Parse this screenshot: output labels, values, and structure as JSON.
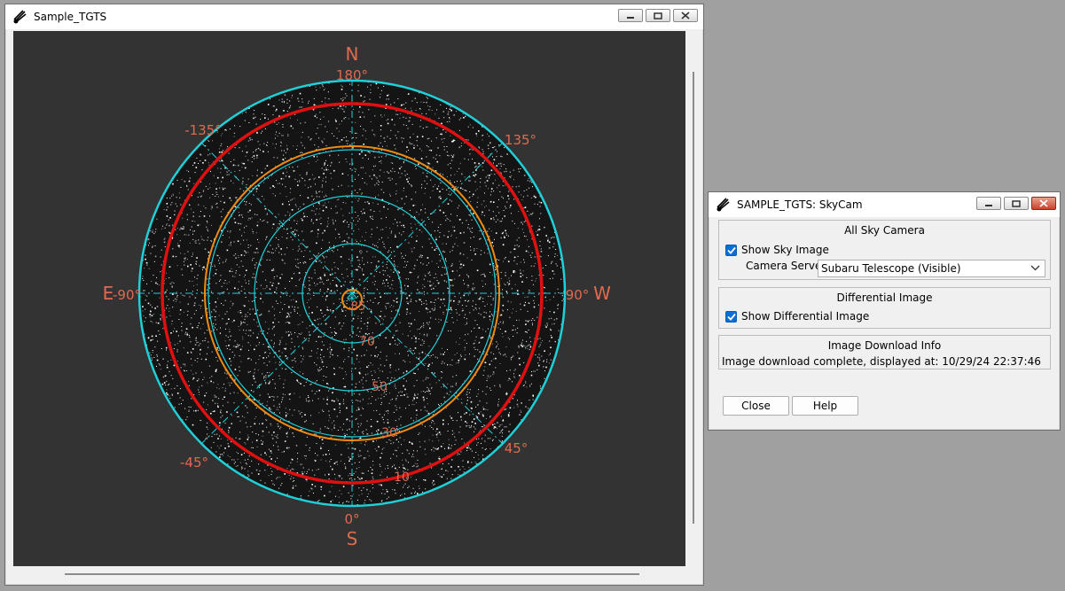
{
  "main_window": {
    "title": "Sample_TGTS"
  },
  "sky_map": {
    "directions": {
      "north": "N",
      "south": "S",
      "east": "E",
      "west": "W"
    },
    "azimuth_labels": {
      "top": "180°",
      "bottom": "0°",
      "left": "-90°",
      "right": "90°",
      "upper_left": "-135°",
      "upper_right": "135°",
      "lower_left": "-45°",
      "lower_right": "45°"
    },
    "elevation_labels": [
      "10",
      "30",
      "50",
      "70",
      "85"
    ],
    "colors": {
      "background": "#333333",
      "grid": "#1fd0d8",
      "red_ring": "#e01010",
      "orange_ring": "#f08a10",
      "labels": "#e06a50"
    }
  },
  "skycam_window": {
    "title": "SAMPLE_TGTS: SkyCam",
    "all_sky_camera": {
      "group_title": "All Sky Camera",
      "show_sky_image_label": "Show Sky Image",
      "show_sky_image_checked": true,
      "camera_server_label": "Camera Server:",
      "camera_server_value": "Subaru Telescope (Visible)"
    },
    "differential_image": {
      "group_title": "Differential Image",
      "show_differential_label": "Show Differential Image",
      "show_differential_checked": true
    },
    "download_info": {
      "group_title": "Image Download Info",
      "status_text": "Image download complete, displayed at: 10/29/24 22:37:46"
    },
    "buttons": {
      "close": "Close",
      "help": "Help"
    }
  }
}
